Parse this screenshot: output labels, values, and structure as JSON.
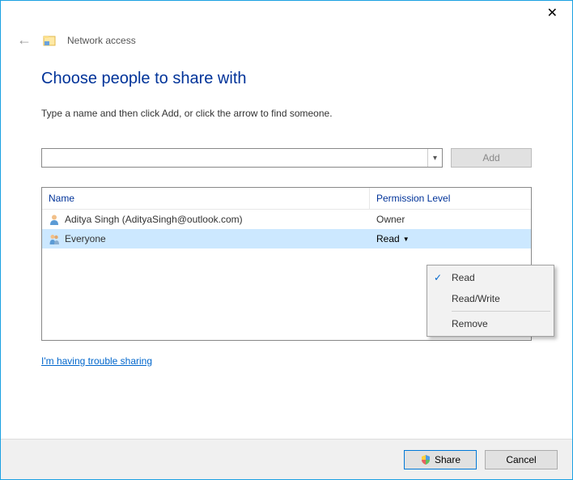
{
  "titlebar": {
    "close": "✕"
  },
  "header": {
    "back": "←",
    "title": "Network access"
  },
  "main": {
    "heading": "Choose people to share with",
    "subtext": "Type a name and then click Add, or click the arrow to find someone.",
    "add_button": "Add",
    "name_input_value": ""
  },
  "table": {
    "columns": {
      "name": "Name",
      "permission": "Permission Level"
    },
    "rows": [
      {
        "name": "Aditya Singh (AdityaSingh@outlook.com)",
        "permission": "Owner",
        "type": "user",
        "selected": false,
        "dropdown": false
      },
      {
        "name": "Everyone",
        "permission": "Read",
        "type": "group",
        "selected": true,
        "dropdown": true
      }
    ]
  },
  "context_menu": {
    "items": [
      {
        "label": "Read",
        "checked": true
      },
      {
        "label": "Read/Write",
        "checked": false
      }
    ],
    "remove": "Remove"
  },
  "trouble_link": "I'm having trouble sharing",
  "buttons": {
    "share": "Share",
    "cancel": "Cancel"
  }
}
